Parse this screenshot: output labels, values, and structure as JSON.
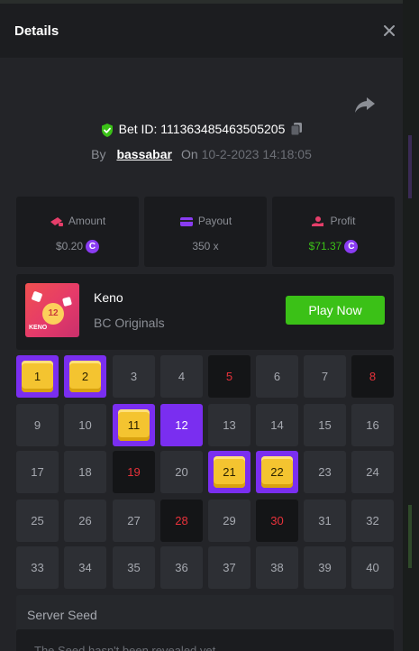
{
  "header": {
    "title": "Details"
  },
  "bet": {
    "id_text": "Bet ID: 111363485463505205",
    "by_label": "By",
    "user": "bassabar",
    "on_label": "On",
    "timestamp": "10-2-2023 14:18:05"
  },
  "stats": {
    "amount": {
      "label": "Amount",
      "value": "$0.20"
    },
    "payout": {
      "label": "Payout",
      "value": "350 x"
    },
    "profit": {
      "label": "Profit",
      "value": "$71.37"
    }
  },
  "game": {
    "name": "Keno",
    "provider": "BC Originals",
    "thumb_ball": "12",
    "thumb_label": "KENO",
    "play_label": "Play Now"
  },
  "coin_glyph": "C",
  "colors": {
    "accent_green": "#3bc117",
    "accent_purple": "#7a2ef0",
    "drawn_red": "#e8323b",
    "panel": "#232428"
  },
  "grid": {
    "cells": [
      {
        "n": "1",
        "state": "hit"
      },
      {
        "n": "2",
        "state": "hit"
      },
      {
        "n": "3",
        "state": "none"
      },
      {
        "n": "4",
        "state": "none"
      },
      {
        "n": "5",
        "state": "drawn"
      },
      {
        "n": "6",
        "state": "none"
      },
      {
        "n": "7",
        "state": "none"
      },
      {
        "n": "8",
        "state": "drawn"
      },
      {
        "n": "9",
        "state": "none"
      },
      {
        "n": "10",
        "state": "none"
      },
      {
        "n": "11",
        "state": "hit"
      },
      {
        "n": "12",
        "state": "picked"
      },
      {
        "n": "13",
        "state": "none"
      },
      {
        "n": "14",
        "state": "none"
      },
      {
        "n": "15",
        "state": "none"
      },
      {
        "n": "16",
        "state": "none"
      },
      {
        "n": "17",
        "state": "none"
      },
      {
        "n": "18",
        "state": "none"
      },
      {
        "n": "19",
        "state": "drawn"
      },
      {
        "n": "20",
        "state": "none"
      },
      {
        "n": "21",
        "state": "hit"
      },
      {
        "n": "22",
        "state": "hit"
      },
      {
        "n": "23",
        "state": "none"
      },
      {
        "n": "24",
        "state": "none"
      },
      {
        "n": "25",
        "state": "none"
      },
      {
        "n": "26",
        "state": "none"
      },
      {
        "n": "27",
        "state": "none"
      },
      {
        "n": "28",
        "state": "drawn"
      },
      {
        "n": "29",
        "state": "none"
      },
      {
        "n": "30",
        "state": "drawn"
      },
      {
        "n": "31",
        "state": "none"
      },
      {
        "n": "32",
        "state": "none"
      },
      {
        "n": "33",
        "state": "none"
      },
      {
        "n": "34",
        "state": "none"
      },
      {
        "n": "35",
        "state": "none"
      },
      {
        "n": "36",
        "state": "none"
      },
      {
        "n": "37",
        "state": "none"
      },
      {
        "n": "38",
        "state": "none"
      },
      {
        "n": "39",
        "state": "none"
      },
      {
        "n": "40",
        "state": "none"
      }
    ]
  },
  "seed": {
    "label": "Server Seed",
    "text": "The Seed hasn't been revealed yet"
  }
}
